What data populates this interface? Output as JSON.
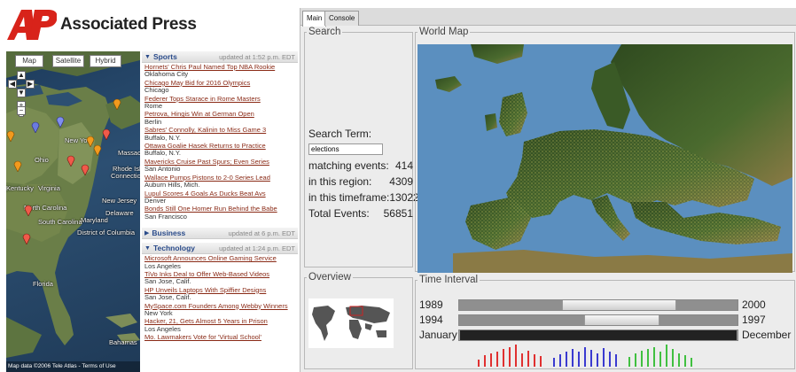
{
  "brand": {
    "name": "Associated Press",
    "mark": "AP",
    "mark_color": "#d8231a"
  },
  "map": {
    "tabs": [
      "Map",
      "Satellite",
      "Hybrid"
    ],
    "labels": [
      "New York",
      "Ohio",
      "Maryland",
      "New Jersey",
      "Delaware",
      "Connecticut",
      "Rhode Island",
      "Massachusetts",
      "Kentucky",
      "Virginia",
      "North Carolina",
      "South Carolina",
      "District of Columbia",
      "Florida",
      "Bahamas"
    ],
    "footer": "Map data ©2006 Tele Atlas - Terms of Use"
  },
  "news": {
    "sections": [
      {
        "category": "Sports",
        "updated": "updated at 1:52 p.m. EDT",
        "expanded": true,
        "items": [
          {
            "headline": "Hornets' Chris Paul Named Top NBA Rookie",
            "location": "Oklahoma City"
          },
          {
            "headline": "Chicago May Bid for 2016 Olympics",
            "location": "Chicago"
          },
          {
            "headline": "Federer Tops Starace in Rome Masters",
            "location": "Rome"
          },
          {
            "headline": "Petrova, Hingis Win at German Open",
            "location": "Berlin"
          },
          {
            "headline": "Sabres' Connolly, Kalinin to Miss Game 3",
            "location": "Buffalo, N.Y."
          },
          {
            "headline": "Ottawa Goalie Hasek Returns to Practice",
            "location": "Buffalo, N.Y."
          },
          {
            "headline": "Mavericks Cruise Past Spurs; Even Series",
            "location": "San Antonio"
          },
          {
            "headline": "Wallace Pumps Pistons to 2-0 Series Lead",
            "location": "Auburn Hills, Mich."
          },
          {
            "headline": "Lupul Scores 4 Goals As Ducks Beat Avs",
            "location": "Denver"
          },
          {
            "headline": "Bonds Still One Homer Run Behind the Babe",
            "location": "San Francisco"
          }
        ]
      },
      {
        "category": "Business",
        "updated": "updated at 6 p.m. EDT",
        "expanded": false,
        "items": []
      },
      {
        "category": "Technology",
        "updated": "updated at 1:24 p.m. EDT",
        "expanded": true,
        "items": [
          {
            "headline": "Microsoft Announces Online Gaming Service",
            "location": "Los Angeles"
          },
          {
            "headline": "TiVo Inks Deal to Offer Web-Based Videos",
            "location": "San Jose, Calif."
          },
          {
            "headline": "HP Unveils Laptops With Spiffier Designs",
            "location": "San Jose, Calif."
          },
          {
            "headline": "MySpace.com Founders Among Webby Winners",
            "location": "New York"
          },
          {
            "headline": "Hacker, 21, Gets Almost 5 Years in Prison",
            "location": "Los Angeles"
          },
          {
            "headline": "Mo. Lawmakers Vote for 'Virtual School'",
            "location": ""
          }
        ]
      }
    ]
  },
  "app": {
    "tabs": [
      "Main",
      "Console"
    ],
    "active_tab": "Main",
    "search": {
      "legend": "Search",
      "term_label": "Search Term:",
      "term_value": "elections",
      "stats": [
        {
          "label": "matching events:",
          "value": "414"
        },
        {
          "label": "in this region:",
          "value": "4309"
        },
        {
          "label": "in this timeframe:",
          "value": "13022"
        },
        {
          "label": "Total Events:",
          "value": "56851"
        }
      ]
    },
    "world_map": {
      "legend": "World Map",
      "sea_color": "#5b8fbf",
      "land_color": "#3f5e2a"
    },
    "overview": {
      "legend": "Overview",
      "highlight_color": "#cc2222"
    },
    "time_interval": {
      "legend": "Time Interval",
      "rows": [
        {
          "left": "1989",
          "right": "2000",
          "range_start": 0.37,
          "range_end": 0.78
        },
        {
          "left": "1994",
          "right": "1997",
          "range_start": 0.45,
          "range_end": 0.72
        },
        {
          "left": "January",
          "right": "December",
          "range_start": 0.0,
          "range_end": 1.0
        }
      ],
      "histogram": {
        "groups": [
          {
            "color": "#e03030",
            "heights": [
              0.3,
              0.45,
              0.55,
              0.62,
              0.7,
              0.8,
              0.9,
              0.55,
              0.65,
              0.5,
              0.42
            ]
          },
          {
            "color": "#3a3ad0",
            "heights": [
              0.35,
              0.5,
              0.6,
              0.72,
              0.6,
              0.8,
              0.68,
              0.55,
              0.75,
              0.62,
              0.5
            ]
          },
          {
            "color": "#40c040",
            "heights": [
              0.4,
              0.55,
              0.65,
              0.72,
              0.8,
              0.62,
              0.88,
              0.7,
              0.55,
              0.45,
              0.35
            ]
          }
        ]
      }
    }
  }
}
